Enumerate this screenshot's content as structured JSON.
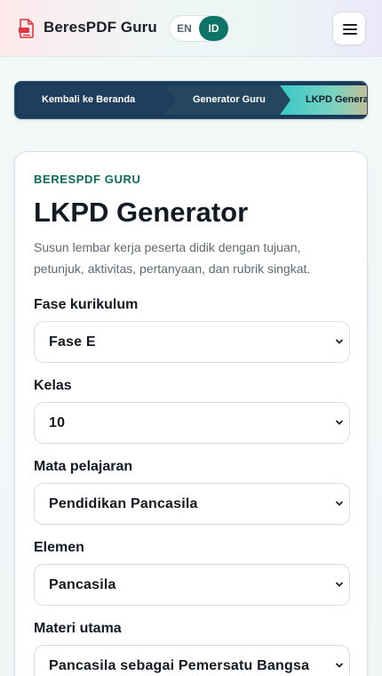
{
  "header": {
    "brand": "BeresPDF Guru",
    "lang": {
      "en": "EN",
      "id": "ID",
      "active": "ID"
    },
    "icons": {
      "logo": "pdf-document-icon",
      "menu": "hamburger-menu-icon"
    },
    "colors": {
      "accent": "#0e7468"
    }
  },
  "breadcrumb": {
    "items": [
      "Kembali ke Beranda",
      "Generator Guru",
      "LKPD Generator"
    ]
  },
  "page": {
    "eyebrow": "BERESPDF GURU",
    "title": "LKPD Generator",
    "description": "Susun lembar kerja peserta didik dengan tujuan, petunjuk, aktivitas, pertanyaan, dan rubrik singkat."
  },
  "form": {
    "fields": [
      {
        "label": "Fase kurikulum",
        "value": "Fase E"
      },
      {
        "label": "Kelas",
        "value": "10"
      },
      {
        "label": "Mata pelajaran",
        "value": "Pendidikan Pancasila"
      },
      {
        "label": "Elemen",
        "value": "Pancasila"
      },
      {
        "label": "Materi utama",
        "value": "Pancasila sebagai Pemersatu Bangsa"
      }
    ]
  }
}
